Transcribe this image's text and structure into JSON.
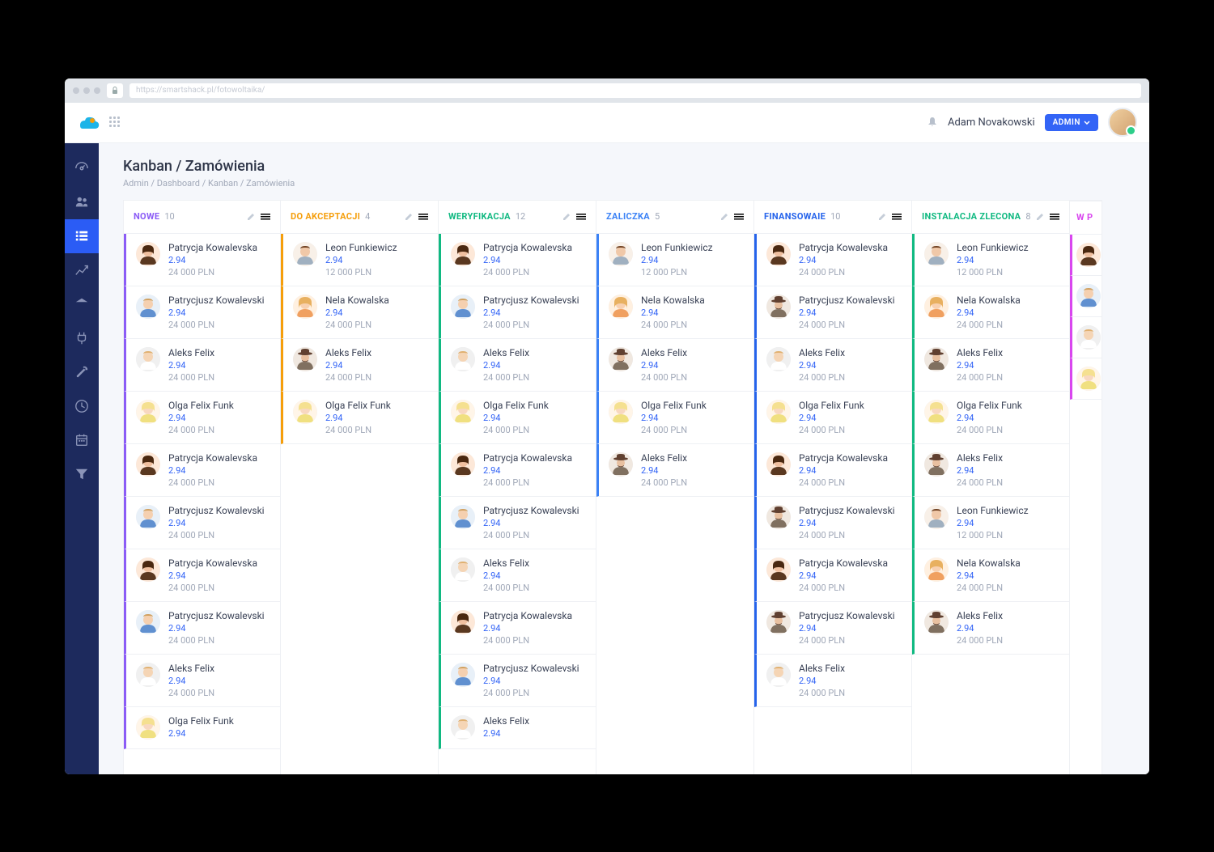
{
  "browser": {
    "url": "https://smartshack.pl/fotowoltaika/"
  },
  "topbar": {
    "user_name": "Adam Novakowski",
    "admin_label": "ADMIN"
  },
  "page": {
    "title": "Kanban / Zamówienia",
    "breadcrumb": [
      "Admin",
      "Dashboard",
      "Kanban / Zamówienia"
    ]
  },
  "avatars": {
    "patrycja": "f1",
    "patrycjusz": "m1",
    "aleks_m": "m2",
    "olga": "f2",
    "leon": "m3",
    "nela": "f3",
    "aleks_hat": "m4"
  },
  "columns": [
    {
      "title": "NOWE",
      "count": 10,
      "color": "#8b5cf6",
      "cards": [
        {
          "name": "Patrycja Kowalevska",
          "metric": "2.94",
          "amount": "24 000 PLN",
          "av": "f1"
        },
        {
          "name": "Patrycjusz Kowalevski",
          "metric": "2.94",
          "amount": "24 000 PLN",
          "av": "m1"
        },
        {
          "name": "Aleks Felix",
          "metric": "2.94",
          "amount": "24 000 PLN",
          "av": "m2"
        },
        {
          "name": "Olga Felix Funk",
          "metric": "2.94",
          "amount": "24 000 PLN",
          "av": "f2"
        },
        {
          "name": "Patrycja Kowalevska",
          "metric": "2.94",
          "amount": "24 000 PLN",
          "av": "f1"
        },
        {
          "name": "Patrycjusz Kowalevski",
          "metric": "2.94",
          "amount": "24 000 PLN",
          "av": "m1"
        },
        {
          "name": "Patrycja Kowalevska",
          "metric": "2.94",
          "amount": "24 000 PLN",
          "av": "f1"
        },
        {
          "name": "Patrycjusz Kowalevski",
          "metric": "2.94",
          "amount": "24 000 PLN",
          "av": "m1"
        },
        {
          "name": "Aleks Felix",
          "metric": "2.94",
          "amount": "24 000 PLN",
          "av": "m2"
        },
        {
          "name": "Olga Felix Funk",
          "metric": "2.94",
          "amount": "",
          "av": "f2"
        }
      ]
    },
    {
      "title": "DO AKCEPTACJI",
      "count": 4,
      "color": "#f59e0b",
      "cards": [
        {
          "name": "Leon Funkiewicz",
          "metric": "2.94",
          "amount": "12 000 PLN",
          "av": "m3"
        },
        {
          "name": "Nela Kowalska",
          "metric": "2.94",
          "amount": "24 000 PLN",
          "av": "f3"
        },
        {
          "name": "Aleks Felix",
          "metric": "2.94",
          "amount": "24 000 PLN",
          "av": "m4"
        },
        {
          "name": "Olga Felix Funk",
          "metric": "2.94",
          "amount": "24 000 PLN",
          "av": "f2"
        }
      ]
    },
    {
      "title": "WERYFIKACJA",
      "count": 12,
      "color": "#10b981",
      "cards": [
        {
          "name": "Patrycja Kowalevska",
          "metric": "2.94",
          "amount": "24 000 PLN",
          "av": "f1"
        },
        {
          "name": "Patrycjusz Kowalevski",
          "metric": "2.94",
          "amount": "24 000 PLN",
          "av": "m1"
        },
        {
          "name": "Aleks Felix",
          "metric": "2.94",
          "amount": "24 000 PLN",
          "av": "m2"
        },
        {
          "name": "Olga Felix Funk",
          "metric": "2.94",
          "amount": "24 000 PLN",
          "av": "f2"
        },
        {
          "name": "Patrycja Kowalevska",
          "metric": "2.94",
          "amount": "24 000 PLN",
          "av": "f1"
        },
        {
          "name": "Patrycjusz Kowalevski",
          "metric": "2.94",
          "amount": "24 000 PLN",
          "av": "m1"
        },
        {
          "name": "Aleks Felix",
          "metric": "2.94",
          "amount": "24 000 PLN",
          "av": "m2"
        },
        {
          "name": "Patrycja Kowalevska",
          "metric": "2.94",
          "amount": "24 000 PLN",
          "av": "f1"
        },
        {
          "name": "Patrycjusz Kowalevski",
          "metric": "2.94",
          "amount": "24 000 PLN",
          "av": "m1"
        },
        {
          "name": "Aleks Felix",
          "metric": "2.94",
          "amount": "",
          "av": "m2"
        }
      ]
    },
    {
      "title": "ZALICZKA",
      "count": 5,
      "color": "#3b82f6",
      "cards": [
        {
          "name": "Leon Funkiewicz",
          "metric": "2.94",
          "amount": "12 000 PLN",
          "av": "m3"
        },
        {
          "name": "Nela Kowalska",
          "metric": "2.94",
          "amount": "24 000 PLN",
          "av": "f3"
        },
        {
          "name": "Aleks Felix",
          "metric": "2.94",
          "amount": "24 000 PLN",
          "av": "m4"
        },
        {
          "name": "Olga Felix Funk",
          "metric": "2.94",
          "amount": "24 000 PLN",
          "av": "f2"
        },
        {
          "name": "Aleks Felix",
          "metric": "2.94",
          "amount": "24 000 PLN",
          "av": "m4"
        }
      ]
    },
    {
      "title": "FINANSOWAIE",
      "count": 10,
      "color": "#2563eb",
      "cards": [
        {
          "name": "Patrycja Kowalevska",
          "metric": "2.94",
          "amount": "24 000 PLN",
          "av": "f1"
        },
        {
          "name": "Patrycjusz Kowalevski",
          "metric": "2.94",
          "amount": "24 000 PLN",
          "av": "m4"
        },
        {
          "name": "Aleks Felix",
          "metric": "2.94",
          "amount": "24 000 PLN",
          "av": "m2"
        },
        {
          "name": "Olga Felix Funk",
          "metric": "2.94",
          "amount": "24 000 PLN",
          "av": "f2"
        },
        {
          "name": "Patrycja Kowalevska",
          "metric": "2.94",
          "amount": "24 000 PLN",
          "av": "f1"
        },
        {
          "name": "Patrycjusz Kowalevski",
          "metric": "2.94",
          "amount": "24 000 PLN",
          "av": "m4"
        },
        {
          "name": "Patrycja Kowalevska",
          "metric": "2.94",
          "amount": "24 000 PLN",
          "av": "f1"
        },
        {
          "name": "Patrycjusz Kowalevski",
          "metric": "2.94",
          "amount": "24 000 PLN",
          "av": "m4"
        },
        {
          "name": "Aleks Felix",
          "metric": "2.94",
          "amount": "24 000 PLN",
          "av": "m2"
        }
      ]
    },
    {
      "title": "INSTALACJA ZLECONA",
      "count": 8,
      "color": "#10b981",
      "cards": [
        {
          "name": "Leon Funkiewicz",
          "metric": "2.94",
          "amount": "12 000 PLN",
          "av": "m3"
        },
        {
          "name": "Nela Kowalska",
          "metric": "2.94",
          "amount": "24 000 PLN",
          "av": "f3"
        },
        {
          "name": "Aleks Felix",
          "metric": "2.94",
          "amount": "24 000 PLN",
          "av": "m4"
        },
        {
          "name": "Olga Felix Funk",
          "metric": "2.94",
          "amount": "24 000 PLN",
          "av": "f2"
        },
        {
          "name": "Aleks Felix",
          "metric": "2.94",
          "amount": "24 000 PLN",
          "av": "m4"
        },
        {
          "name": "Leon Funkiewicz",
          "metric": "2.94",
          "amount": "12 000 PLN",
          "av": "m3"
        },
        {
          "name": "Nela Kowalska",
          "metric": "2.94",
          "amount": "24 000 PLN",
          "av": "f3"
        },
        {
          "name": "Aleks Felix",
          "metric": "2.94",
          "amount": "24 000 PLN",
          "av": "m4"
        }
      ]
    },
    {
      "title": "W P",
      "count": "",
      "color": "#d946ef",
      "partial": true,
      "cards": [
        {
          "name": "",
          "metric": "",
          "amount": "",
          "av": "f1"
        },
        {
          "name": "",
          "metric": "",
          "amount": "",
          "av": "m1"
        },
        {
          "name": "",
          "metric": "",
          "amount": "",
          "av": "m2"
        },
        {
          "name": "",
          "metric": "",
          "amount": "",
          "av": "f2"
        }
      ]
    }
  ],
  "sidebar_icons": [
    "dashboard",
    "users",
    "list",
    "chart",
    "bank",
    "plug",
    "wrench",
    "clock",
    "calendar",
    "filter"
  ]
}
